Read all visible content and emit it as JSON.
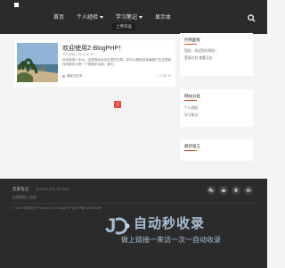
{
  "header": {
    "nav": [
      {
        "label": "首页"
      },
      {
        "label": "个人经验"
      },
      {
        "label": "学习笔记"
      },
      {
        "label": "显示本"
      }
    ],
    "dropdown_tip": "上传作品"
  },
  "post": {
    "title": "欢迎使用Z-BlogPHP！",
    "meta": "个人经验 • 2024-12-13",
    "excerpt": "欢迎使用Z-Blog，这是程序自动生成的文章。您可以删除或者编辑它在这里面找到更多分享一个看更多功能，我们。",
    "category": "最新文件夹",
    "stats": "▢ 0   👁 93"
  },
  "pagination": {
    "current": "1"
  },
  "sidebar": {
    "widget1": {
      "title": "控制面板",
      "line1": "您好，欢迎到访网站！",
      "line2": "登录后台 查看日志"
    },
    "widget2": {
      "title": "网站分类",
      "items": [
        "个人经验",
        "学习笔记"
      ]
    },
    "widget3": {
      "title": "最新留言"
    }
  },
  "footer": {
    "title": "佳家笔记",
    "slogan": "Good Luck To You!",
    "links": "在线短信 | 站长",
    "copyright": "© 2024 佳家笔记 Powered by Z-BlogPHP 浙ICP备00000000号"
  },
  "watermark": {
    "title": "自动秒收录",
    "subtitle": "做上链接一来访一次一自动收录"
  },
  "colors": {
    "accent": "#e74c3c",
    "header_bg": "#2b2b2b",
    "watermark": "#a9bfd5"
  }
}
